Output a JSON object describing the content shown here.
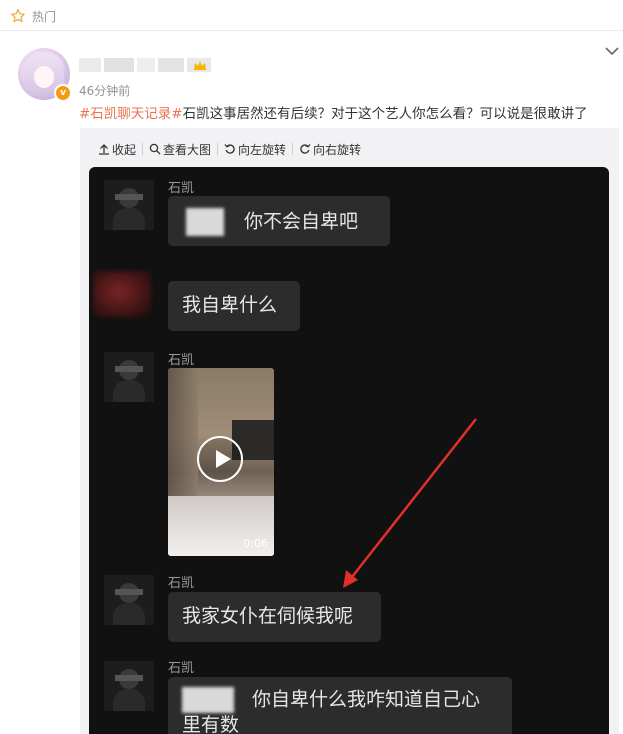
{
  "header": {
    "hot_label": "热门"
  },
  "post": {
    "time": "46分钟前",
    "hashtag": "#石凯聊天记录#",
    "text": "石凯这事居然还有后续？对于这个艺人你怎么看？可以说是很敢讲了"
  },
  "toolbar": {
    "collapse": "收起",
    "view_large": "查看大图",
    "rotate_left": "向左旋转",
    "rotate_right": "向右旋转"
  },
  "chat": {
    "messages": [
      {
        "sender": "石凯",
        "text": "你不会自卑吧"
      },
      {
        "sender": "",
        "text": "我自卑什么"
      },
      {
        "sender": "石凯",
        "video_duration": "0:06"
      },
      {
        "sender": "石凯",
        "text": "我家女仆在伺候我呢"
      },
      {
        "sender": "石凯",
        "text_line1": "你自卑什么我咋知道自己心",
        "text_line2": "里有数"
      }
    ]
  },
  "colors": {
    "hashtag": "#eb7350",
    "arrow": "#e0302b",
    "chat_bg": "#111111",
    "bubble": "#2c2c2c",
    "vip": "#f39c12"
  }
}
